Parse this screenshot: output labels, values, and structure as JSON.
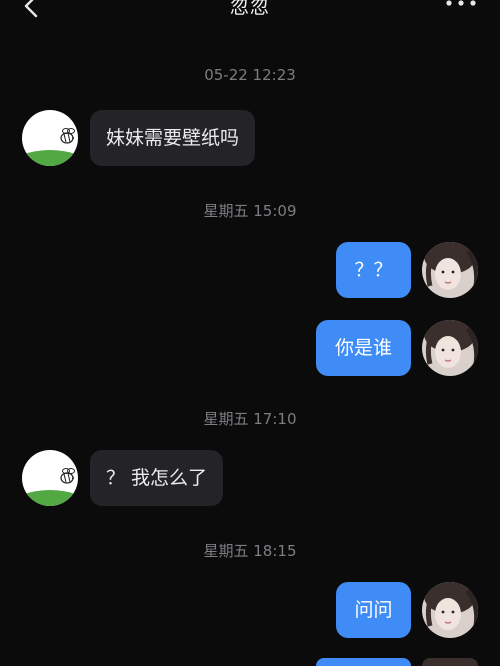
{
  "header": {
    "title": "忽忽",
    "back_icon": "chevron-left-icon",
    "more_icon": "more-dots-icon"
  },
  "messages": [
    {
      "type": "timestamp",
      "text": "05-22 12:23"
    },
    {
      "type": "incoming",
      "text": "妹妹需要壁纸吗"
    },
    {
      "type": "timestamp",
      "text": "星期五 15:09"
    },
    {
      "type": "outgoing",
      "text": "？？"
    },
    {
      "type": "outgoing",
      "text": "你是谁"
    },
    {
      "type": "timestamp",
      "text": "星期五 17:10"
    },
    {
      "type": "incoming",
      "text": "？ 我怎么了"
    },
    {
      "type": "timestamp",
      "text": "星期五 18:15"
    },
    {
      "type": "outgoing",
      "text": "问问"
    }
  ],
  "colors": {
    "background": "#0b0b0c",
    "incoming_bubble": "#242428",
    "outgoing_bubble": "#3f8cf6",
    "timestamp": "#7d7d82"
  }
}
